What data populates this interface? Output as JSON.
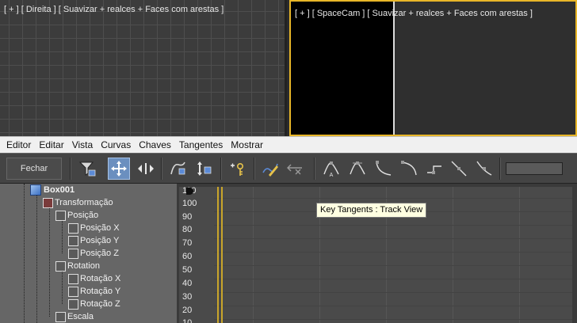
{
  "viewports": {
    "left": {
      "label": "[ + ] [ Direita ] [ Suavizar + realces + Faces com arestas ]"
    },
    "right": {
      "label": "[ + ] [ SpaceCam ] [ Suavizar + realces + Faces com arestas ]"
    }
  },
  "menu": [
    "Editor",
    "Editar",
    "Vista",
    "Curvas",
    "Chaves",
    "Tangentes",
    "Mostrar"
  ],
  "toolbar": {
    "close_label": "Fechar"
  },
  "tree": {
    "root": "Box001",
    "transform": "Transformação",
    "position": "Posição",
    "position_x": "Posição X",
    "position_y": "Posição Y",
    "position_z": "Posição Z",
    "rotation": "Rotation",
    "rotation_x": "Rotação X",
    "rotation_y": "Rotação Y",
    "rotation_z": "Rotação Z",
    "scale": "Escala"
  },
  "graph": {
    "top_label": "110",
    "yticks": [
      "100",
      "90",
      "80",
      "70",
      "60",
      "50",
      "40",
      "30",
      "20",
      "10"
    ]
  },
  "tooltip": "Key Tangents : Track View",
  "colors": {
    "accent": "#e8b628",
    "selected": "#6b8fbf",
    "tooltip_bg": "#ffffe1"
  }
}
